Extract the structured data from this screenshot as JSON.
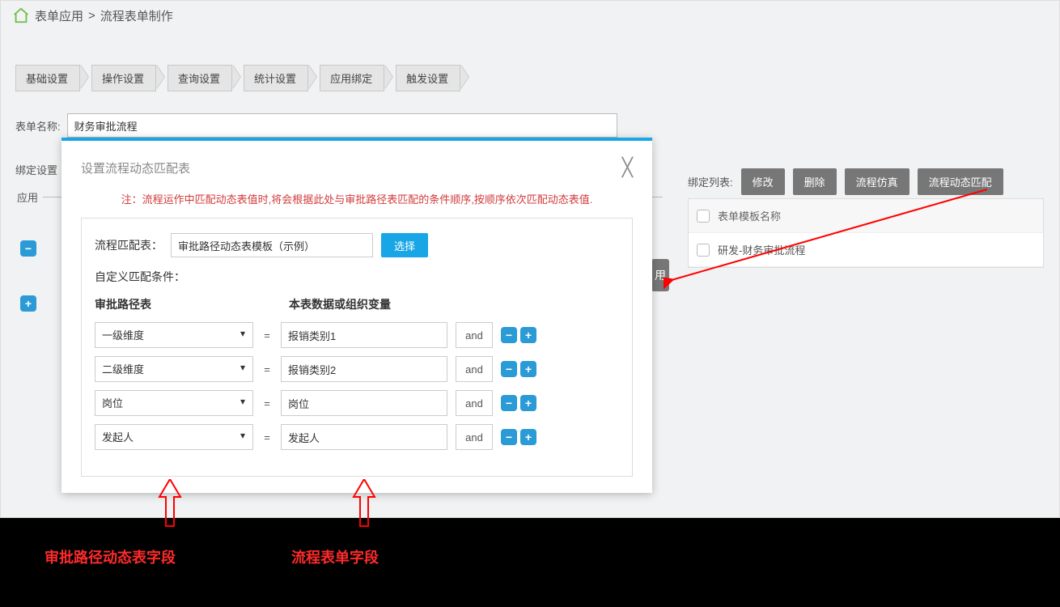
{
  "breadcrumb": {
    "a": "表单应用",
    "sep": ">",
    "b": "流程表单制作"
  },
  "tabs": [
    "基础设置",
    "操作设置",
    "查询设置",
    "统计设置",
    "应用绑定",
    "触发设置"
  ],
  "form_name_label": "表单名称:",
  "form_name_value": "财务审批流程",
  "bind_settings_label": "绑定设置",
  "app_frame_label": "应用",
  "right": {
    "bind_list_label": "绑定列表:",
    "btn_modify": "修改",
    "btn_delete": "删除",
    "btn_sim": "流程仿真",
    "btn_dynmatch": "流程动态匹配",
    "header": "表单模板名称",
    "row1": "研发-财务审批流程"
  },
  "sidebar_partial": "用",
  "modal": {
    "title": "设置流程动态匹配表",
    "note": "注：流程运作中匹配动态表值时,将会根据此处与审批路径表匹配的条件顺序,按顺序依次匹配动态表值.",
    "match_table_label": "流程匹配表：",
    "match_table_value": "审批路径动态表模板（示例）",
    "btn_select": "选择",
    "custom_cond_label": "自定义匹配条件：",
    "col1": "审批路径表",
    "col2": "本表数据或组织变量",
    "rows": [
      {
        "left": "一级维度",
        "right": "报销类别1",
        "op": "and"
      },
      {
        "left": "二级维度",
        "right": "报销类别2",
        "op": "and"
      },
      {
        "left": "岗位",
        "right": "岗位",
        "op": "and"
      },
      {
        "left": "发起人",
        "right": "发起人",
        "op": "and"
      }
    ],
    "eq": "="
  },
  "annotations": {
    "left": "审批路径动态表字段",
    "right": "流程表单字段"
  }
}
